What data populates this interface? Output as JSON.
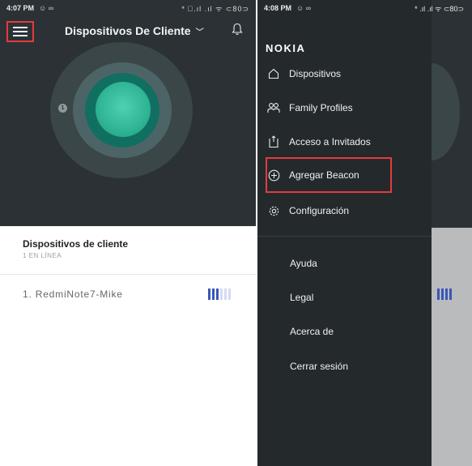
{
  "left": {
    "status": {
      "time": "4:07 PM",
      "extra": "☺ ∞",
      "right": "* ﾞ.ıl .ıl ᯤ ⊂80⊃"
    },
    "header": {
      "title": "Dispositivos De Cliente"
    },
    "satellite": {
      "label": "1"
    },
    "section": {
      "title": "Dispositivos de cliente",
      "subtitle": "1 EN LÍNEA"
    },
    "devices": [
      {
        "label": "1.  RedmiNote7-Mike",
        "signal_level": 0.5
      }
    ],
    "colors": {
      "accent": "#3c55b8",
      "highlight": "#e33b3f"
    }
  },
  "right": {
    "status": {
      "time": "4:08 PM",
      "extra": "☺ ∞",
      "right": "* .ıl .ıl ᯤ ⊂80⊃"
    },
    "brand": "NOKIA",
    "nav": [
      {
        "label": "Dispositivos",
        "icon": "home-icon"
      },
      {
        "label": "Family Profiles",
        "icon": "people-icon"
      },
      {
        "label": "Acceso a Invitados",
        "icon": "guest-access-icon"
      },
      {
        "label": "Agregar Beacon",
        "icon": "plus-circle-icon"
      },
      {
        "label": "Configuración",
        "icon": "gear-icon"
      }
    ],
    "sub_nav": [
      "Ayuda",
      "Legal",
      "Acerca de",
      "Cerrar sesión"
    ]
  }
}
